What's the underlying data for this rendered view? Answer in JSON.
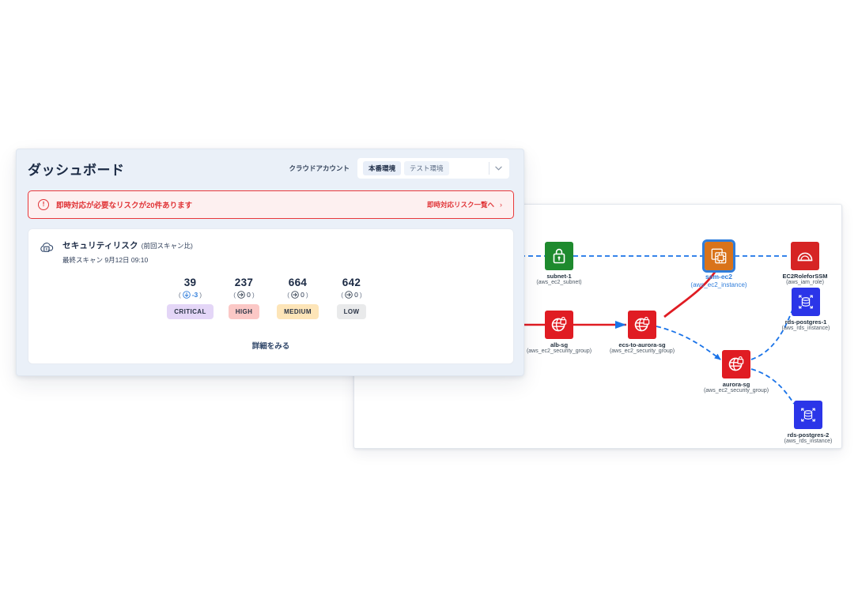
{
  "dashboard": {
    "title": "ダッシュボード",
    "account": {
      "label": "クラウドアカウント",
      "tags": [
        "本番環境",
        "テスト環境"
      ],
      "chevron_icon": "chevron-down-icon"
    },
    "alert": {
      "icon": "exclamation-circle-icon",
      "text": "即時対応が必要なリスクが20件あります",
      "link_text": "即時対応リスク一覧へ",
      "link_chevron": "›",
      "color": "#e03437",
      "background": "#fdf0f0"
    },
    "risk_card": {
      "icon": "cloud-lock-icon",
      "title": "セキュリティリスク",
      "subtitle": "(前回スキャン比)",
      "last_scan": "最終スキャン 9月12日 09:10",
      "detail_link": "詳細をみる",
      "severities": [
        {
          "count": "39",
          "delta": "-3",
          "delta_direction": "down",
          "delta_color": "#2f7ddb",
          "badge": "CRITICAL",
          "badge_bg": "#e4d6f7",
          "badge_fg": "#2a3446"
        },
        {
          "count": "237",
          "delta": "0",
          "delta_direction": "right",
          "delta_color": "#3b4757",
          "badge": "HIGH",
          "badge_bg": "#fbc8c6",
          "badge_fg": "#2a3446"
        },
        {
          "count": "664",
          "delta": "0",
          "delta_direction": "right",
          "delta_color": "#3b4757",
          "badge": "MEDIUM",
          "badge_bg": "#fde5b8",
          "badge_fg": "#2a3446"
        },
        {
          "count": "642",
          "delta": "0",
          "delta_direction": "right",
          "delta_color": "#3b4757",
          "badge": "LOW",
          "badge_bg": "#e9eaeb",
          "badge_fg": "#2a3446"
        }
      ]
    }
  },
  "diagram": {
    "nodes": [
      {
        "id": "subnet-1",
        "name": "subnet-1",
        "type": "(aws_ec2_subnet)",
        "icon": "subnet-lock-icon",
        "color": "#1e8a2e",
        "selected": false
      },
      {
        "id": "ssm-ec2",
        "name": "ssm-ec2",
        "type": "(aws_ec2_instance)",
        "icon": "ec2-instance-icon",
        "color": "#d9731a",
        "selected": true
      },
      {
        "id": "EC2RoleforSSM",
        "name": "EC2RoleforSSM",
        "type": "(aws_iam_role)",
        "icon": "iam-role-icon",
        "color": "#d62424",
        "selected": false
      },
      {
        "id": "rds-postgres-1",
        "name": "rds-postgres-1",
        "type": "(aws_rds_instance)",
        "icon": "rds-database-icon",
        "color": "#2b35e8",
        "selected": false
      },
      {
        "id": "alb-sg",
        "name": "alb-sg",
        "type": "(aws_ec2_security_group)",
        "icon": "security-group-icon",
        "color": "#e01c23",
        "selected": false
      },
      {
        "id": "ecs-to-aurora-sg",
        "name": "ecs-to-aurora-sg",
        "type": "(aws_ec2_security_group)",
        "icon": "security-group-icon",
        "color": "#e01c23",
        "selected": false
      },
      {
        "id": "aurora-sg",
        "name": "aurora-sg",
        "type": "(aws_ec2_security_group)",
        "icon": "security-group-icon",
        "color": "#e01c23",
        "selected": false
      },
      {
        "id": "rds-postgres-2",
        "name": "rds-postgres-2",
        "type": "(aws_rds_instance)",
        "icon": "rds-database-icon",
        "color": "#2b35e8",
        "selected": false
      }
    ],
    "edge_colors": {
      "dashed_blue": "#1a73e8",
      "solid_red": "#e01c23"
    }
  }
}
